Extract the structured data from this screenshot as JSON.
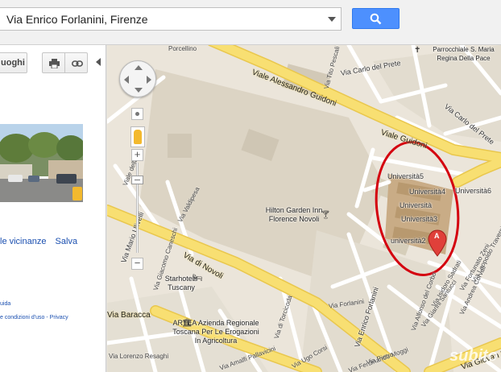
{
  "search": {
    "value": "Via Enrico Forlanini, Firenze"
  },
  "left_panel": {
    "luoghi_label": "uoghi",
    "links": [
      "le vicinanze",
      "Salva"
    ],
    "footer_1": "uida",
    "footer_2": "e condizioni d'uso - Privacy"
  },
  "map": {
    "streets": [
      "Viale Alessandro Guidoni",
      "Viale Guidoni",
      "Via Carlo del Prete",
      "Via Carlo del Prete",
      "Via di Novoli",
      "Via Mario Ulivelli",
      "Via Enrico Forlanini",
      "Via Baracca",
      "Via Giovan F",
      "Via Giacomo Caneschi",
      "Viale della",
      "Via Valdipesa",
      "Via Fortunato Zeni",
      "Via Leopoldo Traversi",
      "Via Andrea Corvali",
      "Via Forlanini",
      "Via Alfonso del Corbo",
      "Via Ferdinando Moggi",
      "Via di Torcicoda",
      "Via Ugo Corsi",
      "Via Isidoro Sadrati",
      "Via Tito Pescali",
      "Via Gianni Santucci",
      "Via Pietro",
      "Via Lorenzo Resaghi",
      "Via Amalfi Pallavicini"
    ],
    "buildings": [
      "Università5",
      "Università4",
      "Università",
      "Università3",
      "università2",
      "Università6"
    ],
    "pois": {
      "hotel": "Hilton Garden Inn Florence Novoli",
      "starhotels": "Starhotels Tuscany",
      "artea": "ARTEA Azienda Regionale Toscana Per Le Erogazioni In Agricoltura",
      "parrocchia": "Parrocchiale S. Maria Regina Della Pace",
      "porcellino": "Porcellino"
    },
    "marker_label": "A",
    "watermark": "subito",
    "highlight_color": "#d4000f",
    "road_color": "#f8df72"
  }
}
